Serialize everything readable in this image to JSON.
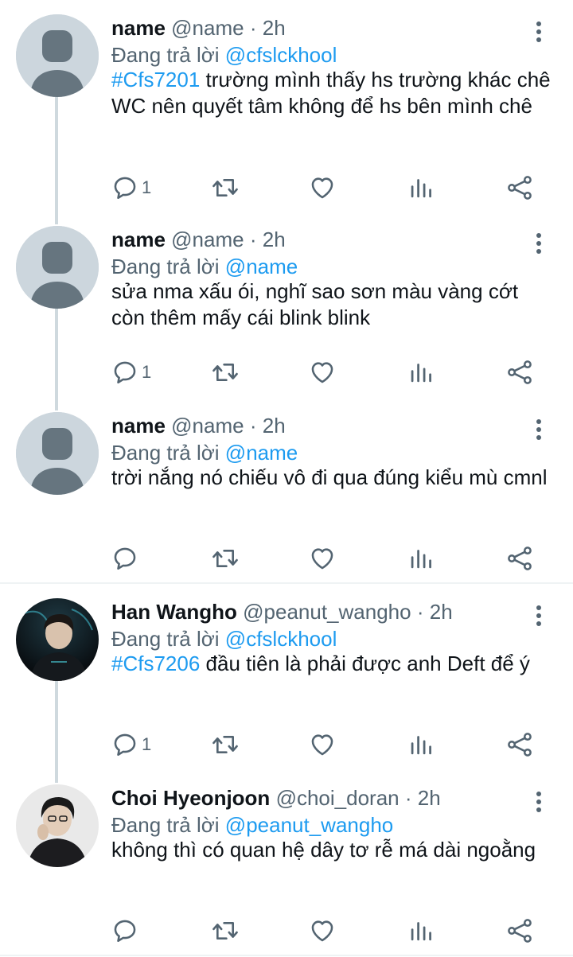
{
  "replying_prefix": "Đang trả lời",
  "colors": {
    "link": "#1d9bf0",
    "secondary": "#536471",
    "thread_line": "#cfd9de"
  },
  "tweets": [
    {
      "name": "name",
      "handle": "@name",
      "time": "2h",
      "reply_to": "@cfslckhool",
      "tag": "#Cfs7201",
      "text": " trường mình thấy hs trường khác chê WC nên quyết tâm không để hs bên mình chê",
      "reply_count": "1",
      "avatar": "default-avatar-icon"
    },
    {
      "name": "name",
      "handle": "@name",
      "time": "2h",
      "reply_to": "@name",
      "tag": "",
      "text": "sửa nma xấu ói, nghĩ sao sơn màu vàng cớt còn thêm mấy cái blink blink",
      "reply_count": "1",
      "avatar": "default-avatar-icon"
    },
    {
      "name": "name",
      "handle": "@name",
      "time": "2h",
      "reply_to": "@name",
      "tag": "",
      "text": "trời nắng nó chiếu vô đi qua đúng kiểu mù cmnl",
      "reply_count": "",
      "avatar": "default-avatar-icon"
    },
    {
      "name": "Han Wangho",
      "handle": "@peanut_wangho",
      "time": "2h",
      "reply_to": "@cfslckhool",
      "tag": "#Cfs7206",
      "text": " đầu tiên là phải được anh Deft để ý",
      "reply_count": "1",
      "avatar": "photo-avatar"
    },
    {
      "name": "Choi Hyeonjoon",
      "handle": "@choi_doran",
      "time": "2h",
      "reply_to": "@peanut_wangho",
      "tag": "",
      "text": "không thì có quan hệ dây tơ rễ má dài ngoằng",
      "reply_count": "",
      "avatar": "photo-avatar"
    }
  ]
}
